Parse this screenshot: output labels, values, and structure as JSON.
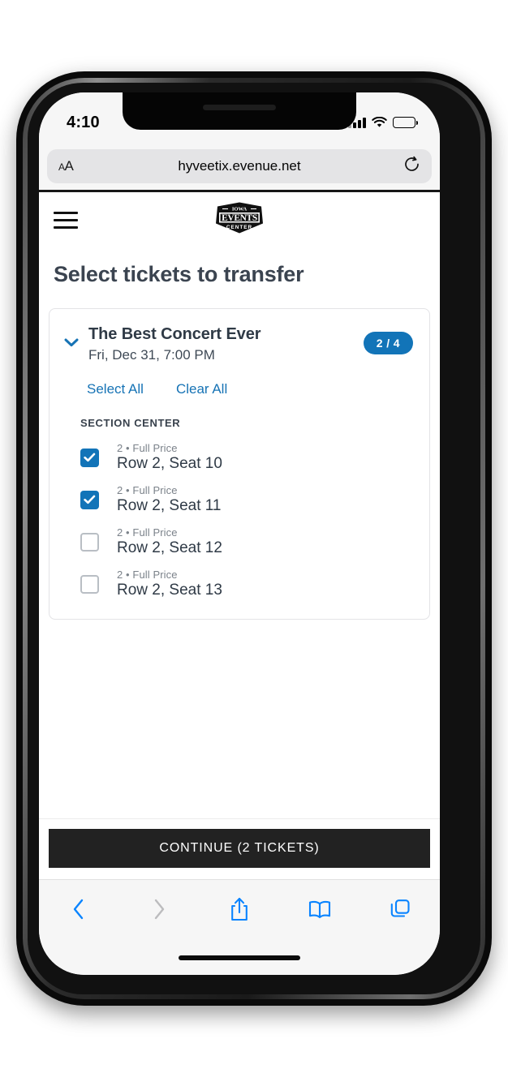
{
  "status_bar": {
    "time": "4:10",
    "signal_icon": "cellular-signal-icon",
    "wifi_icon": "wifi-icon",
    "battery_icon": "battery-icon"
  },
  "browser": {
    "aa_label_small": "A",
    "aa_label_large": "A",
    "url": "hyveetix.evenue.net",
    "reload_icon": "reload-icon",
    "toolbar": {
      "back_icon": "chevron-left-icon",
      "forward_icon": "chevron-right-icon",
      "share_icon": "share-icon",
      "bookmarks_icon": "book-icon",
      "tabs_icon": "tabs-icon"
    }
  },
  "site": {
    "menu_icon": "hamburger-menu-icon",
    "logo": {
      "name": "iowa-events-center-logo",
      "line1": "IOWA",
      "line2": "EVENTS",
      "line3": "CENTER"
    },
    "page_title": "Select tickets to transfer"
  },
  "event_card": {
    "collapse_icon": "chevron-down-icon",
    "name": "The Best Concert Ever",
    "datetime": "Fri, Dec 31, 7:00 PM",
    "count_badge": "2 / 4",
    "select_all_label": "Select All",
    "clear_all_label": "Clear All",
    "section_label": "SECTION CENTER",
    "tickets": [
      {
        "meta": "2 • Full Price",
        "seat": "Row 2, Seat 10",
        "checked": true
      },
      {
        "meta": "2 • Full Price",
        "seat": "Row 2, Seat 11",
        "checked": true
      },
      {
        "meta": "2 • Full Price",
        "seat": "Row 2, Seat 12",
        "checked": false
      },
      {
        "meta": "2 • Full Price",
        "seat": "Row 2, Seat 13",
        "checked": false
      }
    ]
  },
  "cta": {
    "continue_label": "CONTINUE (2 TICKETS)"
  },
  "colors": {
    "accent_blue": "#1274b8",
    "link_blue": "#1673b5",
    "ios_blue": "#0a84ff",
    "cta_dark": "#222222",
    "title_slate": "#3b4450"
  }
}
